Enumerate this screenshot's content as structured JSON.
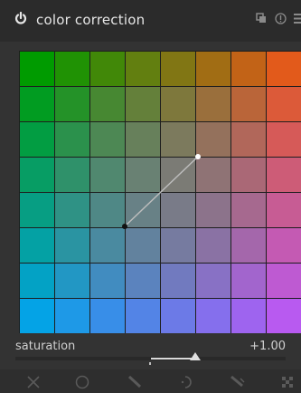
{
  "header": {
    "title": "color correction",
    "icons": [
      "power-icon",
      "presets-icon",
      "reset-icon",
      "menu-icon"
    ]
  },
  "grid": {
    "columns": 8,
    "rows": 8,
    "corner_colors": {
      "top_left": "#009b00",
      "top_right": "#e25a1b",
      "bottom_left": "#04a3e6",
      "bottom_right": "#b85af0"
    },
    "center_point_color": "#111111",
    "handle_point_color": "#ffffff",
    "line_color": "#bdbdbd"
  },
  "slider": {
    "label": "saturation",
    "value": "+1.00",
    "level_fraction": 0.66
  },
  "toolbar": {
    "icons": [
      "close-icon",
      "circle-icon",
      "pen-icon",
      "brush-icon",
      "draw-icon",
      "checker-icon"
    ]
  }
}
